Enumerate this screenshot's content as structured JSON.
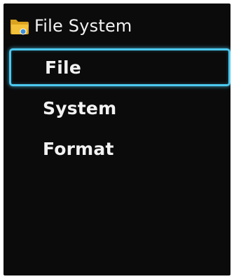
{
  "header": {
    "title": "File System",
    "icon": "folder-icon"
  },
  "menu": {
    "items": [
      {
        "label": "File",
        "selected": true
      },
      {
        "label": "System",
        "selected": false
      },
      {
        "label": "Format",
        "selected": false
      }
    ]
  },
  "colors": {
    "background": "#0b0b0b",
    "text": "#f2f2f2",
    "selection_border": "#4cc8ef",
    "folder": "#f4c23a"
  }
}
